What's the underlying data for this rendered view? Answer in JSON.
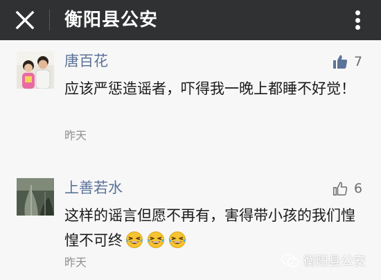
{
  "header": {
    "title": "衡阳县公安",
    "close_icon": "close-icon",
    "more_icon": "more-vertical-icon",
    "background": "#2f3132"
  },
  "comments": [
    {
      "author": "唐百花",
      "likes": "7",
      "content": "应该严惩造谣者，吓得我一晚上都睡不好觉！",
      "time": "昨天",
      "liked": true
    },
    {
      "author": "上善若水",
      "likes": "6",
      "content": "这样的谣言但愿不再有，害得带小孩的我们惶惶不可终",
      "emoji": [
        "crying-laughing-emoji",
        "crying-laughing-emoji",
        "crying-laughing-emoji"
      ],
      "time": "昨天",
      "liked": false
    }
  ],
  "watermark": {
    "text": "衡阳县公安"
  },
  "colors": {
    "author_name": "#5b7399",
    "like_active": "#5b7399",
    "like_inactive": "#6c6c6c",
    "time": "#8f8f8f"
  }
}
